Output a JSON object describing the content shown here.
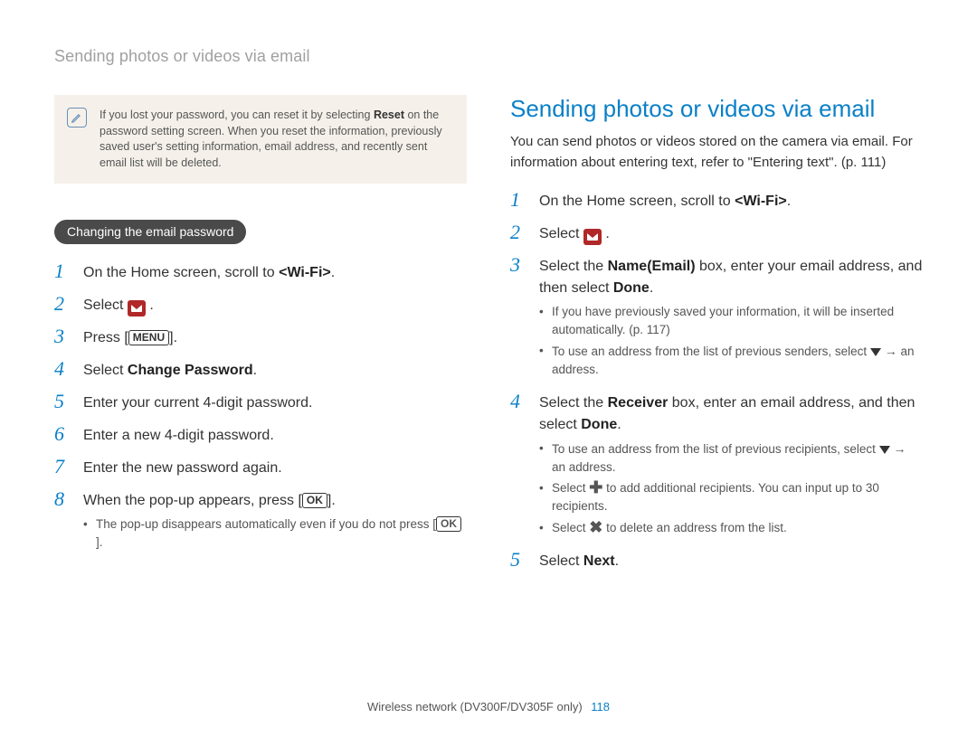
{
  "running_header": "Sending photos or videos via email",
  "note": {
    "prefix": "If you lost your password, you can reset it by selecting ",
    "bold": "Reset",
    "suffix": " on the password setting screen. When you reset the information, previously saved user's setting information, email address, and recently sent email list will be deleted."
  },
  "left": {
    "pill": "Changing the email password",
    "steps": {
      "s1": {
        "pre": "On the Home screen, scroll to ",
        "bold": "<Wi-Fi>",
        "post": "."
      },
      "s2": {
        "pre": "Select ",
        "post": " ."
      },
      "s3": {
        "pre": "Press [",
        "glyph": "MENU",
        "post": "]."
      },
      "s4": {
        "pre": "Select ",
        "bold": "Change Password",
        "post": "."
      },
      "s5": "Enter your current 4-digit password.",
      "s6": "Enter a new 4-digit password.",
      "s7": "Enter the new password again.",
      "s8": {
        "pre": "When the pop-up appears, press [",
        "glyph": "OK",
        "post": "]."
      },
      "s8_sub": {
        "pre": "The pop-up disappears automatically even if you do not press [",
        "glyph": "OK",
        "post": "]."
      }
    }
  },
  "right": {
    "title": "Sending photos or videos via email",
    "intro": "You can send photos or videos stored on the camera via email. For information about entering text, refer to \"Entering text\". (p. 111)",
    "steps": {
      "s1": {
        "pre": "On the Home screen, scroll to ",
        "bold": "<Wi-Fi>",
        "post": "."
      },
      "s2": {
        "pre": "Select ",
        "post": " ."
      },
      "s3": {
        "pre": "Select the ",
        "bold1": "Name(Email)",
        "mid": " box, enter your email address, and then select ",
        "bold2": "Done",
        "post": "."
      },
      "s3_sub1": "If you have previously saved your information, it will be inserted automatically. (p. 117)",
      "s3_sub2": {
        "pre": "To use an address from the list of previous senders, select ",
        "post": " an address."
      },
      "s4": {
        "pre": "Select the ",
        "bold1": "Receiver",
        "mid": " box, enter an email address, and then select ",
        "bold2": "Done",
        "post": "."
      },
      "s4_sub1": {
        "pre": "To use an address from the list of previous recipients, select ",
        "post": " an address."
      },
      "s4_sub2": {
        "pre": "Select ",
        "post": " to add additional recipients. You can input up to 30 recipients."
      },
      "s4_sub3": {
        "pre": "Select ",
        "post": " to delete an address from the list."
      },
      "s5": {
        "pre": "Select ",
        "bold": "Next",
        "post": "."
      }
    }
  },
  "footer": {
    "text": "Wireless network (DV300F/DV305F only)",
    "page": "118"
  },
  "icons": {
    "note": "pencil-note-icon",
    "email": "email-app-icon",
    "menu": "MENU",
    "ok": "OK",
    "down": "triangle-down-icon",
    "plus": "plus-icon",
    "x": "x-icon",
    "arrow": "→"
  }
}
